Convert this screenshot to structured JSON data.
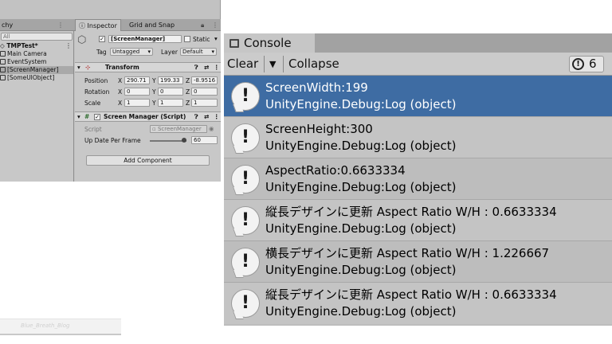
{
  "editor": {
    "tabs": {
      "hierarchy": "chy",
      "inspector": "Inspector",
      "grid_snap": "Grid and Snap"
    },
    "hierarchy": {
      "search": "All",
      "scene": "TMPTest*",
      "items": [
        "Main Camera",
        "EventSystem",
        "[ScreenManager]",
        "[SomeUIObject]"
      ]
    },
    "inspector": {
      "object_name": "[ScreenManager]",
      "static_label": "Static",
      "tag_label": "Tag",
      "tag_value": "Untagged",
      "layer_label": "Layer",
      "layer_value": "Default",
      "transform": {
        "title": "Transform",
        "rows": [
          {
            "label": "Position",
            "x": "290.71",
            "y": "199.33",
            "z": "-8.9516"
          },
          {
            "label": "Rotation",
            "x": "0",
            "y": "0",
            "z": "0"
          },
          {
            "label": "Scale",
            "x": "1",
            "y": "1",
            "z": "1"
          }
        ]
      },
      "script_component": {
        "title": "Screen Manager (Script)",
        "script_label": "Script",
        "script_value": "ScreenManager",
        "update_label": "Up Date Per Frame",
        "update_value": "60",
        "update_fraction": 1.0
      },
      "add_component": "Add Component"
    },
    "watermark": "Blue_Breath_Blog"
  },
  "console": {
    "tab_label": "Console",
    "toolbar": {
      "clear": "Clear",
      "collapse": "Collapse",
      "count": "6"
    },
    "logs": [
      {
        "line1": "ScreenWidth:199",
        "line2": "UnityEngine.Debug:Log (object)",
        "selected": true
      },
      {
        "line1": "ScreenHeight:300",
        "line2": "UnityEngine.Debug:Log (object)",
        "selected": false
      },
      {
        "line1": "AspectRatio:0.6633334",
        "line2": "UnityEngine.Debug:Log (object)",
        "selected": false
      },
      {
        "line1": "縦長デザインに更新 Aspect Ratio W/H : 0.6633334",
        "line2": "UnityEngine.Debug:Log (object)",
        "selected": false
      },
      {
        "line1": "横長デザインに更新 Aspect Ratio W/H : 1.226667",
        "line2": "UnityEngine.Debug:Log (object)",
        "selected": false
      },
      {
        "line1": "縦長デザインに更新 Aspect Ratio W/H : 0.6633334",
        "line2": "UnityEngine.Debug:Log (object)",
        "selected": false
      }
    ],
    "colors": {
      "selected_row": "#3e6ca3",
      "background": "#bdbdbd"
    },
    "icons": {
      "log": "info-bubble-icon"
    }
  }
}
